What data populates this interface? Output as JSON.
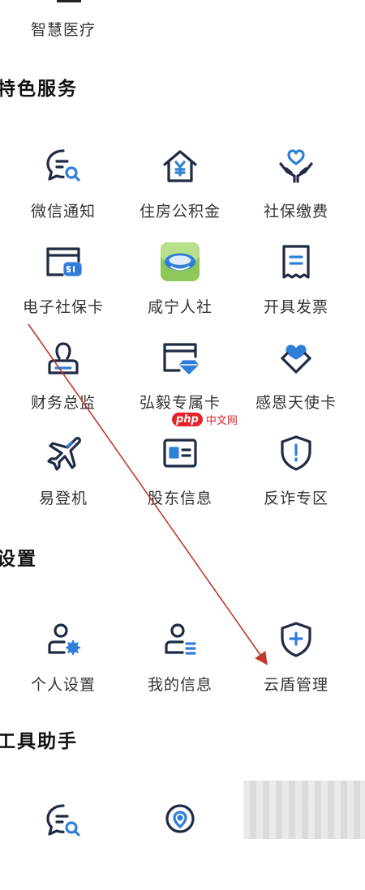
{
  "top": {
    "label": "智慧医疗"
  },
  "sections": {
    "special": {
      "title": "特色服务"
    },
    "settings": {
      "title": "设置"
    },
    "tools": {
      "title": "工具助手"
    }
  },
  "special_items": [
    {
      "label": "微信通知",
      "icon": "chat-search-icon"
    },
    {
      "label": "住房公积金",
      "icon": "house-yuan-icon"
    },
    {
      "label": "社保缴费",
      "icon": "heart-hands-icon"
    },
    {
      "label": "电子社保卡",
      "icon": "si-card-icon"
    },
    {
      "label": "咸宁人社",
      "icon": "app-logo-icon"
    },
    {
      "label": "开具发票",
      "icon": "invoice-icon"
    },
    {
      "label": "财务总监",
      "icon": "stamp-icon"
    },
    {
      "label": "弘毅专属卡",
      "icon": "card-diamond-icon"
    },
    {
      "label": "感恩天使卡",
      "icon": "angel-heart-icon"
    },
    {
      "label": "易登机",
      "icon": "airplane-icon"
    },
    {
      "label": "股东信息",
      "icon": "id-card-icon"
    },
    {
      "label": "反诈专区",
      "icon": "shield-alert-icon"
    }
  ],
  "settings_items": [
    {
      "label": "个人设置",
      "icon": "user-gear-icon"
    },
    {
      "label": "我的信息",
      "icon": "user-info-icon"
    },
    {
      "label": "云盾管理",
      "icon": "shield-plus-icon"
    }
  ],
  "tools_items": [
    {
      "icon": "chat-search-icon"
    },
    {
      "icon": "location-pin-icon"
    }
  ],
  "watermark": {
    "php": "php",
    "text": "中文网"
  },
  "colors": {
    "dark": "#1f2a44",
    "blue": "#2f7fd8"
  }
}
